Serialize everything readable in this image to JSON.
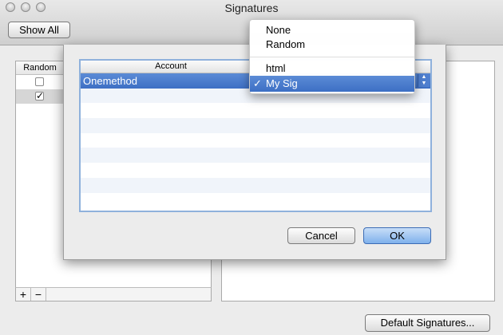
{
  "window": {
    "title": "Signatures",
    "show_all_label": "Show All"
  },
  "left_panel": {
    "column_header": "Random",
    "rows": [
      {
        "checked": false
      },
      {
        "checked": true
      }
    ]
  },
  "footer": {
    "add_label": "+",
    "remove_label": "−"
  },
  "default_signatures_label": "Default Signatures...",
  "sheet": {
    "column_account": "Account",
    "rows": [
      {
        "account": "Onemethod",
        "signature": "My Sig"
      }
    ],
    "cancel_label": "Cancel",
    "ok_label": "OK"
  },
  "menu": {
    "items": [
      "None",
      "Random",
      "html",
      "My Sig"
    ],
    "selected": "My Sig",
    "checkmark": "✓"
  },
  "colors": {
    "accent": "#3d6fc4",
    "ok_button": "#7fb1ec"
  }
}
